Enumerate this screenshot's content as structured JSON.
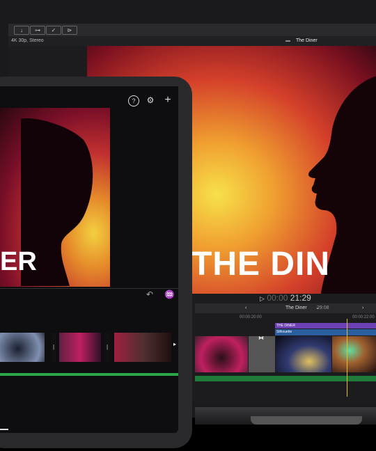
{
  "mac": {
    "toolbar": [
      "↓",
      "⊶",
      "✓",
      "⊳"
    ],
    "format": "4K 30p, Stereo",
    "project_title": "The Diner",
    "viewer_title": "THE DIN",
    "timecode_prefix": "00:00",
    "timecode": "21:29",
    "timeline_project": "The Diner",
    "timeline_duration": "29:08",
    "ruler_left": "00:00:20:00",
    "ruler_right": "00:00:22:00",
    "title_clip": "THE DINER",
    "blue_clip": "Silhouette"
  },
  "ipad": {
    "help_icon": "?",
    "settings_icon": "⚙",
    "add_icon": "+",
    "video_title": "ER",
    "undo_icon": "↶",
    "audio_icon": "♒"
  }
}
